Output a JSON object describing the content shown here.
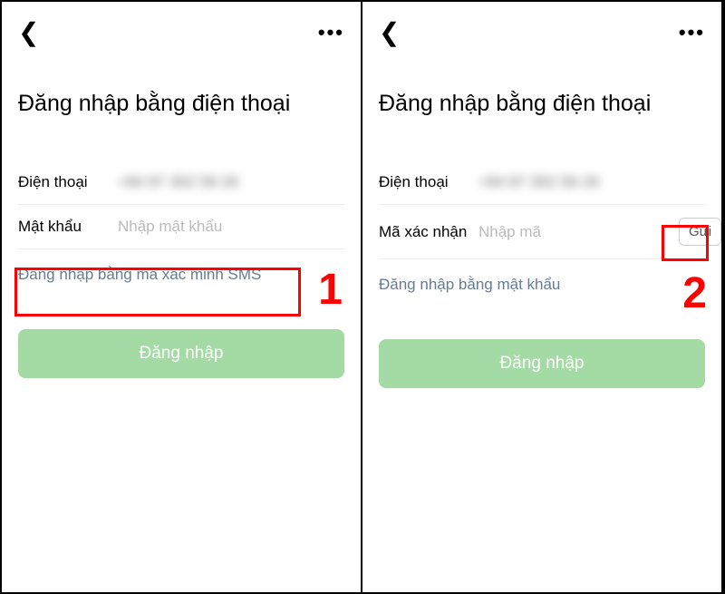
{
  "left": {
    "title": "Đăng nhập bằng điện thoại",
    "phone_label": "Điện thoại",
    "phone_value_blurred": "+84 97 352 59 29",
    "password_label": "Mật khẩu",
    "password_placeholder": "Nhập mật khẩu",
    "sms_link": "Đăng nhập bằng mã xác minh SMS",
    "login_button": "Đăng nhập",
    "step_number": "1"
  },
  "right": {
    "title": "Đăng nhập bằng điện thoại",
    "phone_label": "Điện thoại",
    "phone_value_blurred": "+84 97 352 59 29",
    "code_label": "Mã xác nhận",
    "code_placeholder": "Nhập mã",
    "send_button": "Gửi",
    "password_link": "Đăng nhập bằng mật khẩu",
    "login_button": "Đăng nhập",
    "step_number": "2"
  },
  "colors": {
    "highlight": "#ff0000",
    "link": "#667b93",
    "button_bg": "#a4dba4"
  }
}
